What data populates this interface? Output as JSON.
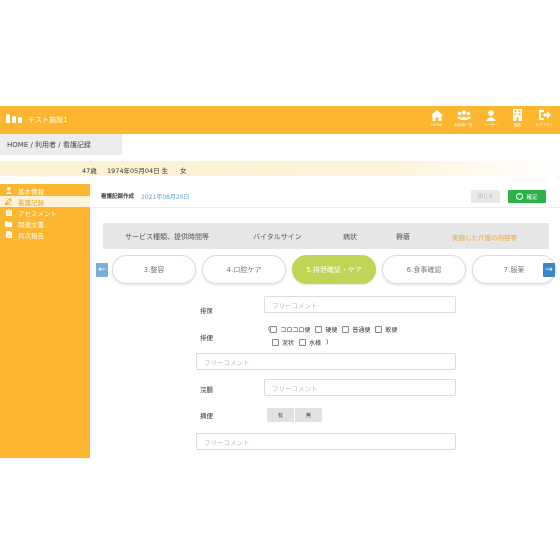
{
  "app": {
    "brand": "テスト施設1",
    "nav": [
      {
        "label": "HOME",
        "icon": "home-icon"
      },
      {
        "label": "利用者一覧",
        "icon": "users-icon"
      },
      {
        "label": "ユーザー",
        "icon": "user-icon"
      },
      {
        "label": "施設",
        "icon": "building-icon"
      },
      {
        "label": "ログアウト",
        "icon": "logout-icon"
      }
    ]
  },
  "breadcrumb": "HOME / 利用者 / 看護記録",
  "patient": {
    "age": "47歳",
    "dob": "1974年05月04日 生",
    "sex": "女"
  },
  "sidebar": [
    {
      "label": "基本情報",
      "icon": "person-icon",
      "active": false
    },
    {
      "label": "看護記録",
      "icon": "record-icon",
      "active": true
    },
    {
      "label": "アセスメント",
      "icon": "clipboard-icon",
      "active": false
    },
    {
      "label": "関連文書",
      "icon": "folder-icon",
      "active": false
    },
    {
      "label": "月次報告",
      "icon": "file-icon",
      "active": false
    }
  ],
  "record": {
    "title": "看護記録作成",
    "date": "2021年08月20日",
    "close_label": "閉じる",
    "confirm_label": "確定"
  },
  "sections": [
    "サービス種類、提供時間等",
    "バイタルサイン",
    "病状",
    "褥瘡",
    "実施した介護の内容等"
  ],
  "tabs": [
    "3.整容",
    "4.口腔ケア",
    "5.排泄確認・ケア",
    "6.食事確認",
    "7.服薬"
  ],
  "active_tab_index": 2,
  "form": {
    "urine_label": "排尿",
    "placeholder": "フリーコメント",
    "stool_label": "排便",
    "stool_options": [
      "コロコロ便",
      "硬便",
      "普通便",
      "軟便",
      "泥状",
      "水様"
    ],
    "stool_open": "(",
    "stool_close": ")",
    "enema_label": "浣腸",
    "incontinence_label": "摘便",
    "toggle_options": [
      "有",
      "無"
    ]
  },
  "colors": {
    "brand": "#fdb62f",
    "active_tab": "#c1d455",
    "confirm": "#2bb34a",
    "link": "#5aa0d6"
  }
}
